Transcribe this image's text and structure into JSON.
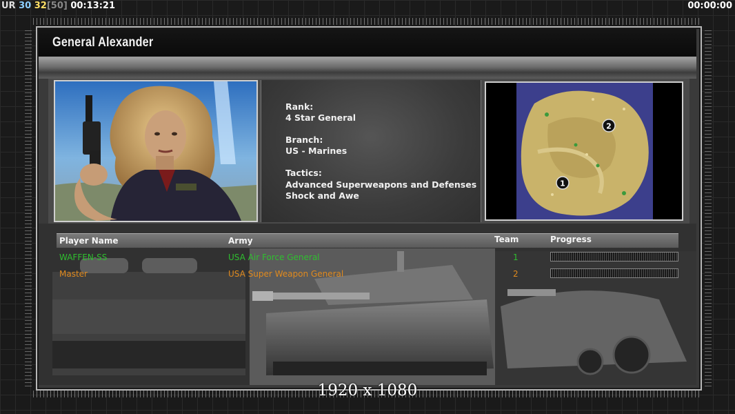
{
  "hud": {
    "ur_label": "UR",
    "stat1": "30",
    "stat2": "32",
    "stat3": "[50]",
    "elapsed": "00:13:21",
    "timer": "00:00:00"
  },
  "general": {
    "name": "General Alexander",
    "rank_label": "Rank:",
    "rank_value": "4 Star General",
    "branch_label": "Branch:",
    "branch_value": "US - Marines",
    "tactics_label": "Tactics:",
    "tactics_line1": "Advanced Superweapons and Defenses",
    "tactics_line2": "Shock and Awe"
  },
  "minimap": {
    "start_positions": [
      "1",
      "2"
    ]
  },
  "table": {
    "headers": {
      "player": "Player Name",
      "army": "Army",
      "team": "Team",
      "progress": "Progress"
    },
    "rows": [
      {
        "player": "WAFFEN-SS",
        "army": "USA Air Force General",
        "team": "1",
        "color": "#2fbf2f"
      },
      {
        "player": "Master",
        "army": "USA Super Weapon General",
        "team": "2",
        "color": "#e08a1e"
      }
    ]
  },
  "resolution": "1920 x 1080",
  "colors": {
    "player1": "#2fbf2f",
    "player2": "#e08a1e",
    "map_water": "#3c3f8c",
    "map_land": "#c9b36a"
  }
}
